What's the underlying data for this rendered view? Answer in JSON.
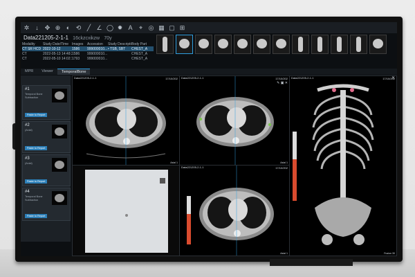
{
  "study": {
    "title": "Data221205-2-1-1",
    "subtitle": "16ckzcxikzw",
    "age": "70y"
  },
  "study_table": {
    "headers": [
      "Modality",
      "Study Date/Time",
      "Images",
      "Accession",
      "Study Description",
      "Body Part"
    ],
    "rows": [
      [
        "CT SR HCD",
        "2022-10-12",
        "1586",
        "999000010...",
        "• TSB, SBT",
        "CHEST_A"
      ],
      [
        "CT",
        "2022-05-13 14:48:28",
        "1586",
        "999000010...",
        "",
        "CHEST_A"
      ],
      [
        "CT",
        "2022-05-10 14:02:14",
        "1793",
        "999000010...",
        "",
        "CHEST_A"
      ]
    ]
  },
  "tabs": [
    "MPR",
    "Viewer",
    "TemporalBone"
  ],
  "series_cards": [
    {
      "num": "#1",
      "desc": "Temporal Bone Subtraction",
      "button": "Paste to Report"
    },
    {
      "num": "#2",
      "desc": "(Axial)",
      "button": "Paste to Report"
    },
    {
      "num": "#3",
      "desc": "(Axial)",
      "button": "Paste to Report"
    },
    {
      "num": "#4",
      "desc": "Temporal Bone Subtraction",
      "button": "Paste to Report"
    }
  ],
  "viewports": {
    "tl": {
      "head": "Data221205-2-1-1",
      "date": "17/10/202",
      "foot": "Axial 1"
    },
    "tr": {
      "head": "Data221205-2-1-1",
      "date": "17/10/202",
      "foot": "Axial 1"
    },
    "br": {
      "head": "Data221205-2-1-1",
      "date": "17/10/202",
      "foot": "Axial 1"
    },
    "vr": {
      "head": "Data221205-2-1-1",
      "date": "17/10/202",
      "foot": "Fusion 30"
    }
  },
  "colorbar": {
    "label": "0"
  },
  "colors": {
    "accent": "#2f9fe0",
    "panel": "#1c2126",
    "screen": "#0c0f12"
  }
}
